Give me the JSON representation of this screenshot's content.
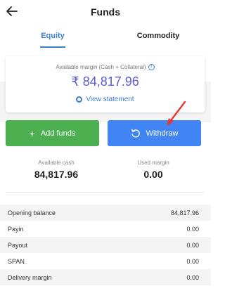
{
  "header": {
    "title": "Funds",
    "back_icon": "arrow-left-icon"
  },
  "tabs": [
    {
      "label": "Equity",
      "active": true
    },
    {
      "label": "Commodity",
      "active": false
    }
  ],
  "summary": {
    "margin_label": "Available margin (Cash + Collateral)",
    "margin_value": "₹ 84,817.96",
    "view_statement": "View statement"
  },
  "actions": {
    "add_funds": "Add funds",
    "withdraw": "Withdraw"
  },
  "stats": {
    "available_cash_label": "Available cash",
    "available_cash_value": "84,817.96",
    "used_margin_label": "Used margin",
    "used_margin_value": "0.00"
  },
  "rows": [
    {
      "label": "Opening balance",
      "value": "84,817.96"
    },
    {
      "label": "Payin",
      "value": "0.00"
    },
    {
      "label": "Payout",
      "value": "0.00"
    },
    {
      "label": "SPAN",
      "value": "0.00"
    },
    {
      "label": "Delivery margin",
      "value": "0.00"
    }
  ],
  "colors": {
    "accent": "#387ed1",
    "add_funds_bg": "#4caf50",
    "withdraw_bg": "#4184f3",
    "margin_value": "#5b5bd6",
    "annotation_arrow": "#e53935"
  }
}
